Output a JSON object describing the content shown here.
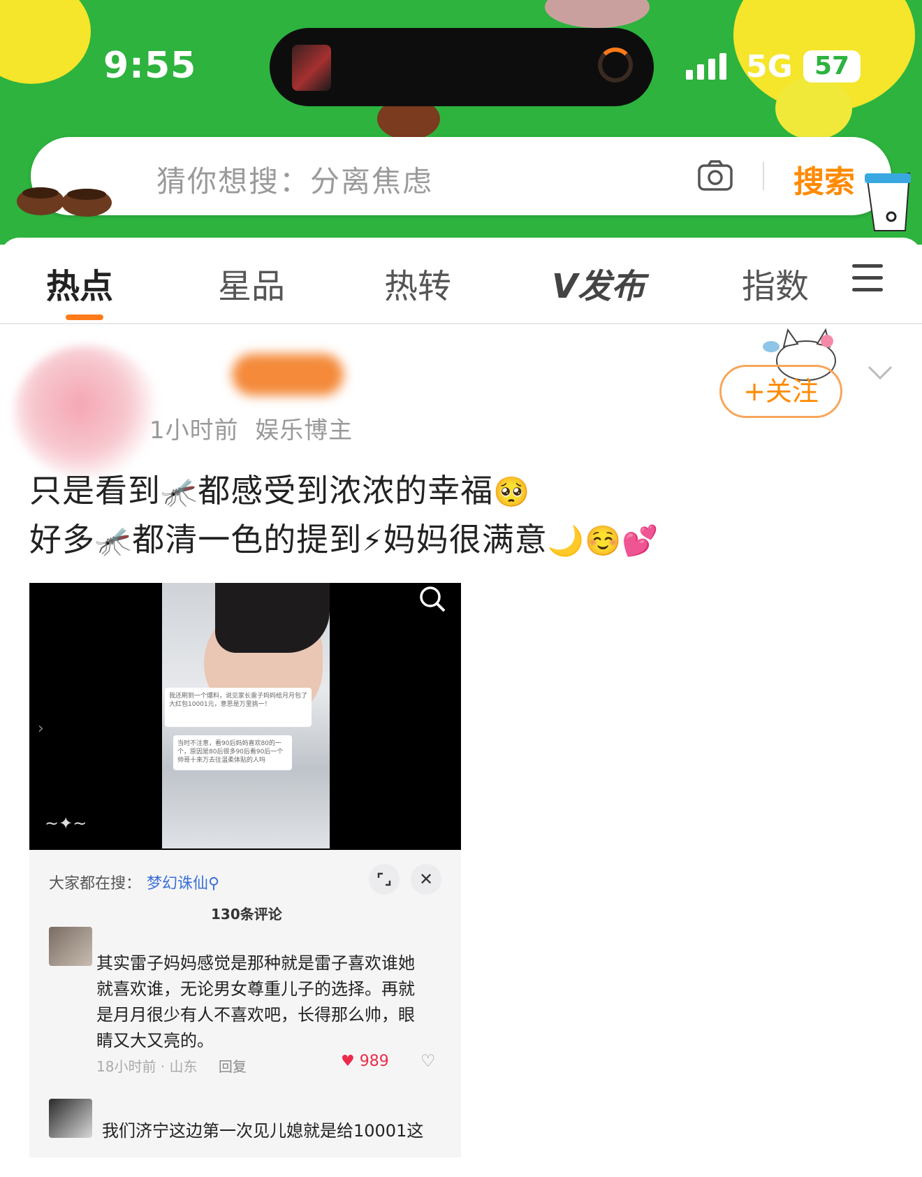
{
  "status_bar": {
    "time": "9:55",
    "network": "5G",
    "battery": "57"
  },
  "search": {
    "placeholder": "猜你想搜：分离焦虑",
    "button_label": "搜索"
  },
  "decor": {
    "coffee_left": "GOODME COFFEE",
    "coffee_cup": "Goodme Coffee"
  },
  "tabs": {
    "items": [
      {
        "label": "热点",
        "active": true
      },
      {
        "label": "星品",
        "active": false
      },
      {
        "label": "热转",
        "active": false
      },
      {
        "label": "V发布",
        "active": false
      },
      {
        "label": "指数",
        "active": false
      }
    ]
  },
  "post": {
    "time_ago": "1小时前",
    "author_tag": "娱乐博主",
    "follow_label": "+关注",
    "line1": "只是看到",
    "line1_b": "都感受到浓浓的幸福",
    "line2": "好多",
    "line2_b": "都清一色的提到",
    "line2_c": "妈妈很满意"
  },
  "embedded": {
    "trending_label": "大家都在搜：",
    "trending_term": "梦幻诛仙",
    "comment_count": "130条评论",
    "comment1_text": "其实雷子妈妈感觉是那种就是雷子喜欢谁她就喜欢谁，无论男女尊重儿子的选择。再就是月月很少有人不喜欢吧，长得那么帅，眼睛又大又亮的。",
    "comment1_time": "18小时前 · 山东",
    "comment1_reply": "回复",
    "comment1_likes": "989",
    "comment2_text": "我们济宁这边第一次见儿媳就是给10001这",
    "overlay1": "我还刷到一个爆料，说见家长雷子妈妈给月月包了大红包10001元，意思是万里挑一！",
    "overlay2": "当时不注意，看90后妈妈喜欢80的一个，原因是80后很多90后看90后一个帅哥十来万去往温柔体贴的人吗"
  },
  "colors": {
    "accent": "#ff8a00",
    "header_green": "#2db33e"
  }
}
